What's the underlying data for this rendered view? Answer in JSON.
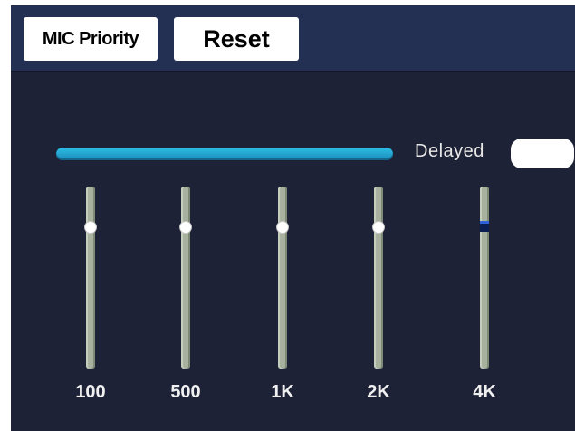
{
  "toolbar": {
    "mic_priority_label": "MIC Priority",
    "reset_label": "Reset"
  },
  "delayed": {
    "label": "Delayed",
    "enabled": false
  },
  "master_slider": {
    "level": 1.0
  },
  "bands": [
    {
      "label": "100",
      "level": 0.75
    },
    {
      "label": "500",
      "level": 0.75
    },
    {
      "label": "1K",
      "level": 0.75
    },
    {
      "label": "2K",
      "level": 0.75
    },
    {
      "label": "4K",
      "level": 0.75
    }
  ],
  "colors": {
    "background": "#1e2236",
    "topbar": "#233054",
    "master_slider": "#2ac0e6",
    "track": "#a7b19d"
  }
}
